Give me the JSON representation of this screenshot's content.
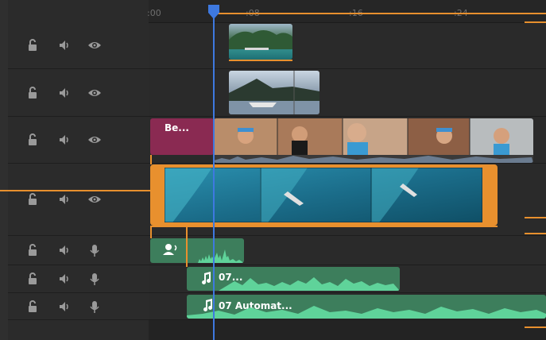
{
  "ruler": {
    "ticks": [
      ":00",
      ":08",
      ":16",
      ":24"
    ]
  },
  "tracks": [
    {
      "lock": "lock-open-icon",
      "audio": "speaker-icon",
      "third": "eye-icon"
    },
    {
      "lock": "lock-open-icon",
      "audio": "speaker-icon",
      "third": "eye-icon"
    },
    {
      "lock": "lock-open-icon",
      "audio": "speaker-icon",
      "third": "eye-icon"
    },
    {
      "lock": "lock-open-icon",
      "audio": "speaker-icon",
      "third": "eye-icon"
    },
    {
      "lock": "lock-open-icon",
      "audio": "speaker-icon",
      "third": "microphone-icon"
    },
    {
      "lock": "lock-open-icon",
      "audio": "speaker-icon",
      "third": "microphone-icon"
    },
    {
      "lock": "lock-open-icon",
      "audio": "speaker-icon",
      "third": "microphone-icon"
    }
  ],
  "clips": {
    "title_clip_label": "Be...",
    "audio_clip_2_label": "07...",
    "audio_clip_3_label": "07 Automat..."
  },
  "colors": {
    "accent_orange": "#e8902e",
    "playhead_blue": "#3e79e0",
    "title_clip": "#8a2a52",
    "audio_green": "#3d7e5c",
    "waveform_green": "#5fd39a"
  }
}
